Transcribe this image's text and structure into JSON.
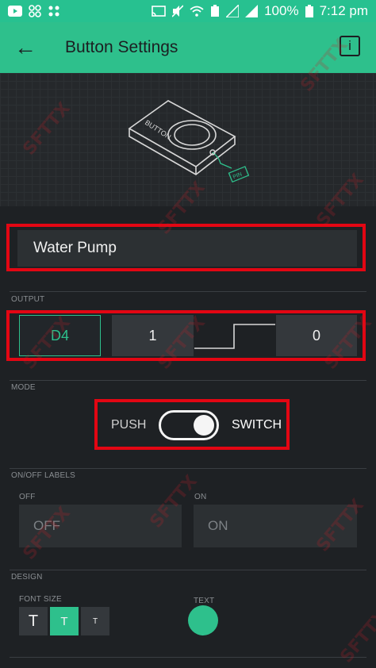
{
  "status_bar": {
    "battery": "100%",
    "time": "7:12 pm",
    "icons_left": [
      "youtube-icon",
      "grid-icon",
      "apps-icon"
    ],
    "icons_right": [
      "cast-icon",
      "mute-icon",
      "wifi-icon",
      "battery-saver-icon",
      "signal-icon",
      "signal-icon",
      "battery-icon"
    ]
  },
  "appbar": {
    "back_icon": "←",
    "title": "Button Settings",
    "info_icon": "i"
  },
  "hero": {
    "button_label": "BUTTON",
    "pin_label": "PIN"
  },
  "widget_name": {
    "value": "Water Pump"
  },
  "output": {
    "label": "OUTPUT",
    "pin": "D4",
    "value_high": "1",
    "value_low": "0"
  },
  "mode": {
    "label": "MODE",
    "push_label": "PUSH",
    "switch_label": "SWITCH",
    "selected": "SWITCH"
  },
  "labels": {
    "section": "ON/OFF LABELS",
    "off_caption": "OFF",
    "on_caption": "ON",
    "off_placeholder": "OFF",
    "on_placeholder": "ON"
  },
  "design": {
    "section": "DESIGN",
    "font_size_label": "FONT SIZE",
    "text_label": "TEXT",
    "font_sizes": [
      "T",
      "T",
      "T"
    ],
    "selected_font_size": 1,
    "text_color": "#2ec08c"
  },
  "colors": {
    "accent": "#2ec08c",
    "highlight": "#e30613",
    "background": "#1e2124"
  },
  "watermark": "SFTTX"
}
